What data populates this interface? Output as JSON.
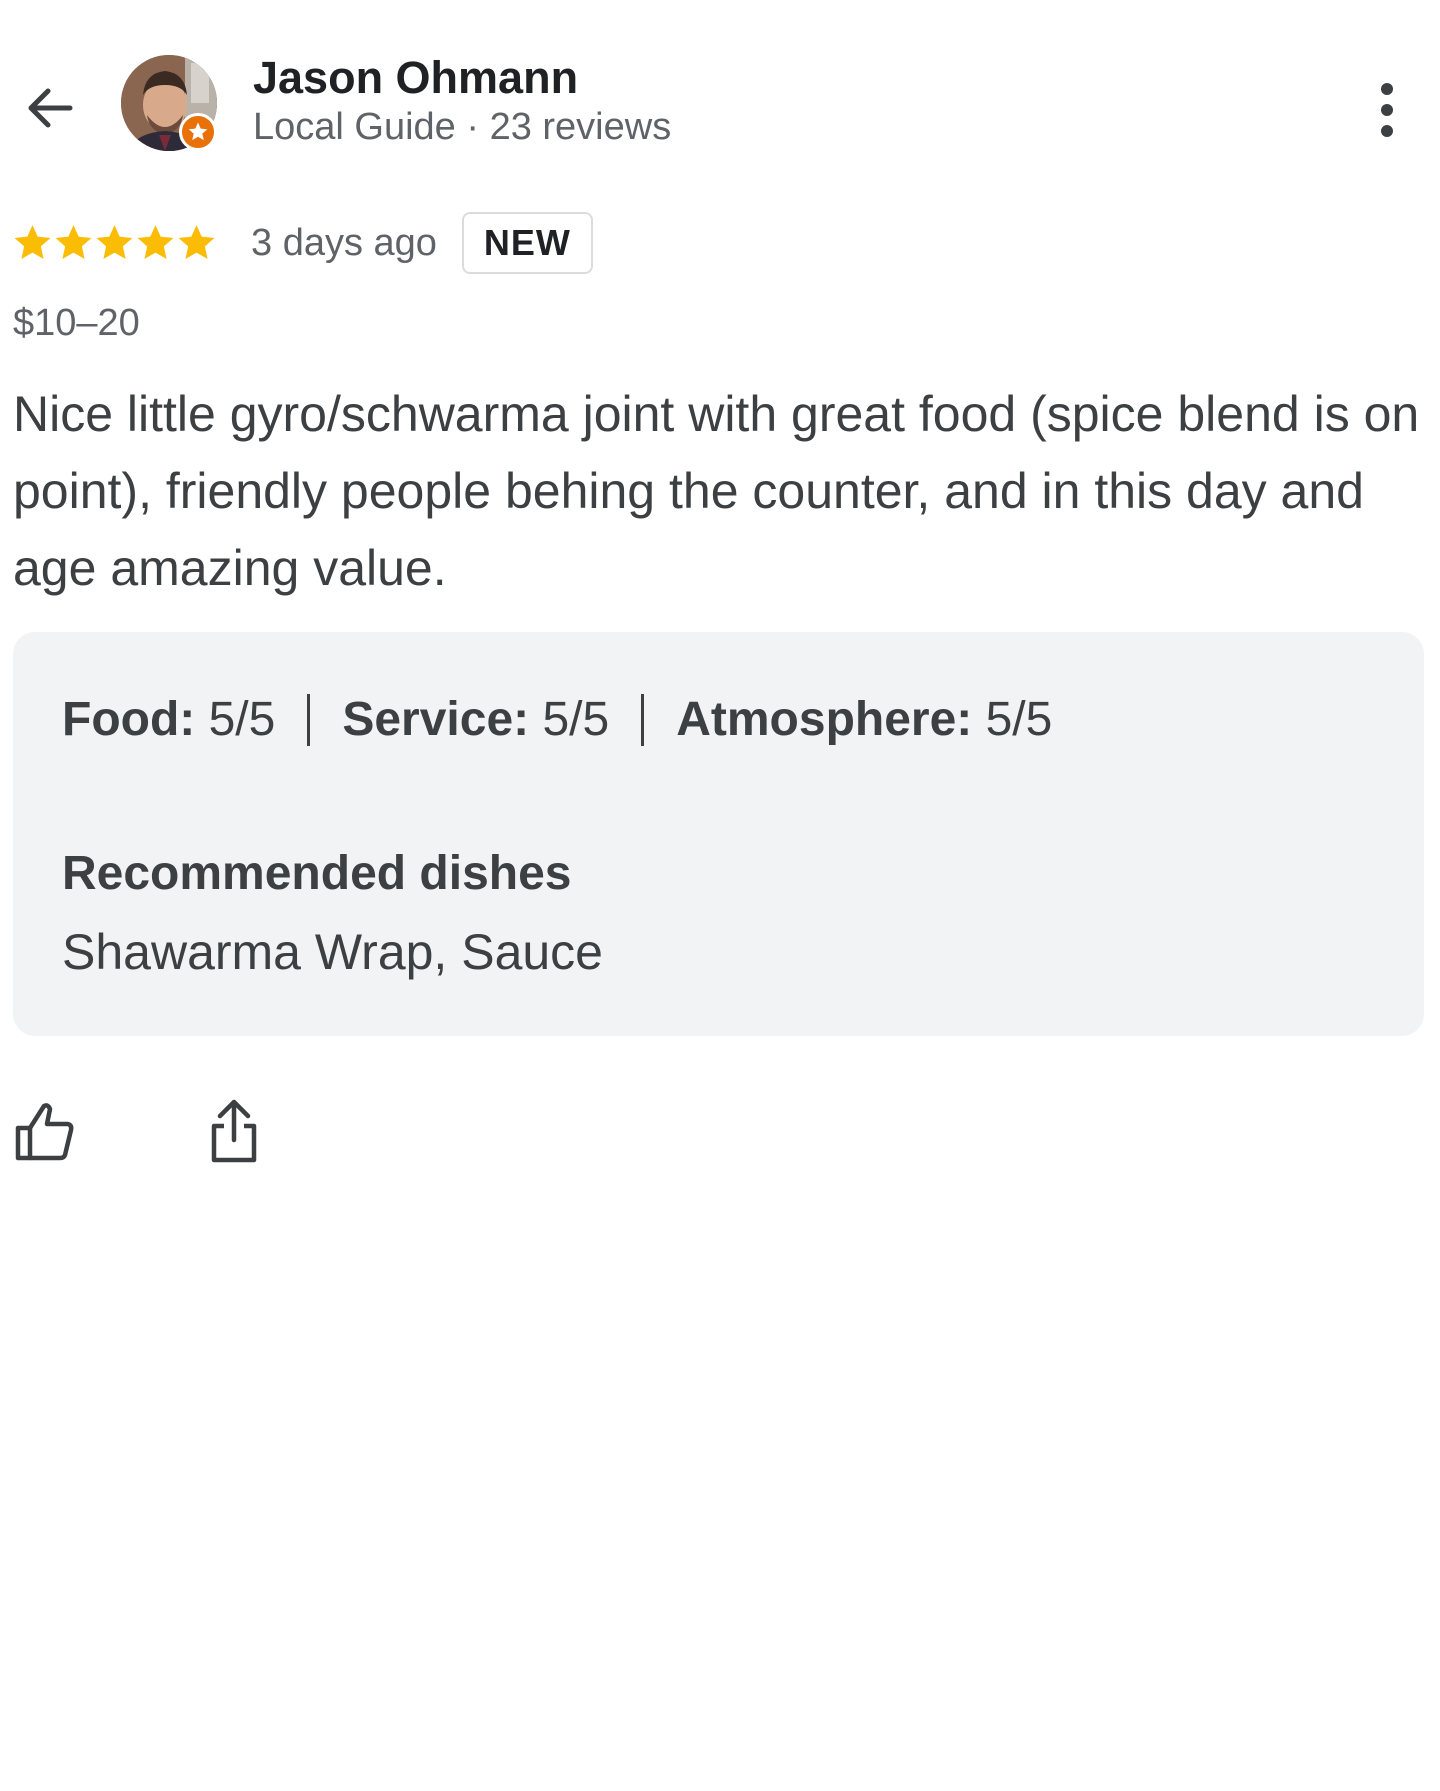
{
  "header": {
    "author_name": "Jason Ohmann",
    "author_meta": "Local Guide · 23 reviews",
    "back_icon": "arrow-left-icon",
    "more_icon": "more-vert-icon",
    "badge_icon": "local-guide-star-icon"
  },
  "review": {
    "rating": 5,
    "rating_max": 5,
    "star_color": "#fbbc04",
    "date": "3 days ago",
    "badge": "NEW",
    "price": "$10–20",
    "text": "Nice little gyro/schwarma joint with great food (spice blend is on point), friendly people behing the counter, and in this day and age amazing value."
  },
  "details": {
    "food_label": "Food:",
    "food_value": "5/5",
    "service_label": "Service:",
    "service_value": "5/5",
    "atmosphere_label": "Atmosphere:",
    "atmosphere_value": "5/5",
    "recommended_title": "Recommended dishes",
    "recommended_dishes": "Shawarma Wrap, Sauce"
  },
  "actions": {
    "like_icon": "thumb-up-icon",
    "share_icon": "share-icon"
  },
  "colors": {
    "badge_orange": "#e8710a",
    "card_background": "#f1f3f4"
  }
}
